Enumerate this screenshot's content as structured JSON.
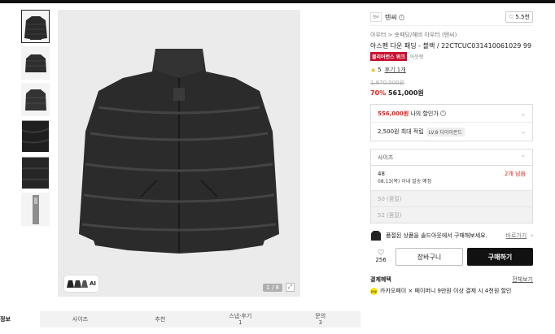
{
  "brand": {
    "logo_text": "텐씨",
    "name": "텐씨",
    "likes": "5.5천"
  },
  "breadcrumb": "아우터 > 숏패딩/헤비 아우터 (텐씨)",
  "product": {
    "title": "아스펜 다운 패딩 - 블랙 / 22CTCUC031410061029 99",
    "badge_label": "클리어런스 위크",
    "badge_extra": "아웃렛",
    "rating": "5",
    "reviews": "후기 1개",
    "original_price": "1,870,000원",
    "discount": "70%",
    "price": "561,000원"
  },
  "coupon": {
    "price": "556,000원",
    "label": "나의 할인가"
  },
  "points": {
    "text": "2,500원 최대 적립",
    "level": "LV.8 다이아몬드"
  },
  "size": {
    "placeholder": "사이즈",
    "options": [
      {
        "name": "48",
        "sub": "08.13(목) 이내 발송 예정",
        "stock": "2개 남음"
      },
      {
        "name": "50 (품절)"
      },
      {
        "name": "52 (품절)"
      }
    ]
  },
  "notice": {
    "text": "품절된 상품을 솔드아웃에서 구매해보세요.",
    "link": "바로가기"
  },
  "actions": {
    "like_count": "256",
    "cart": "장바구니",
    "buy": "구매하기"
  },
  "benefits": {
    "title": "결제혜택",
    "all_link": "전체보기",
    "kakao_icon": "pay",
    "kakao_text": "카카오페이 × 페이머니 9만원 이상 결제 시 4천원 할인"
  },
  "gallery": {
    "page_indicator": "1 / 8",
    "ai_label": "AI"
  },
  "tabs": [
    {
      "label": "정보"
    },
    {
      "label": "사이즈"
    },
    {
      "label": "추천"
    },
    {
      "label": "스냅·후기",
      "count": "1"
    },
    {
      "label": "문의",
      "count": "3"
    }
  ]
}
